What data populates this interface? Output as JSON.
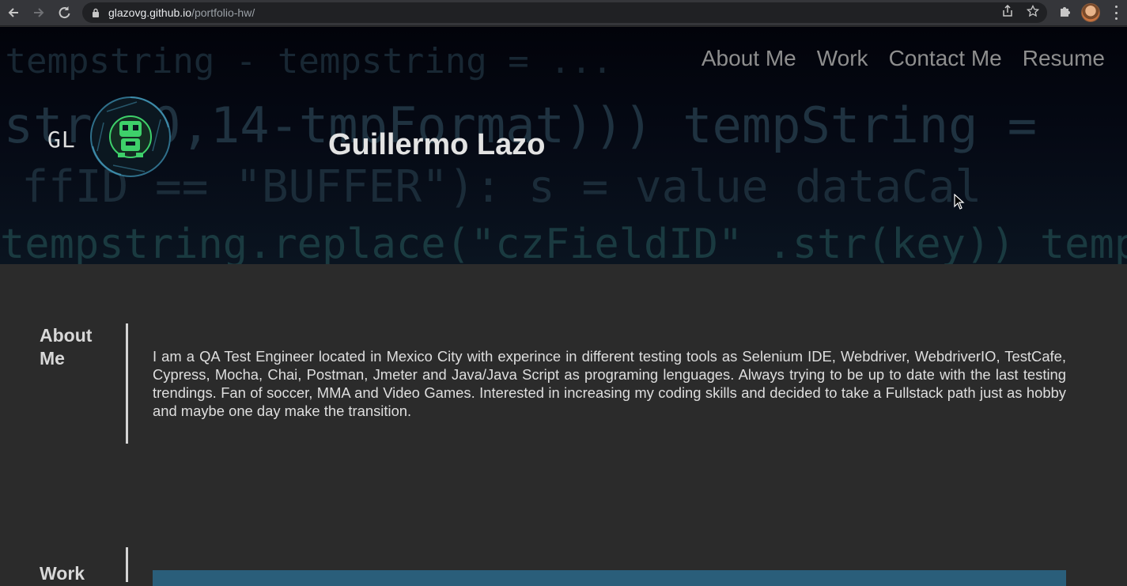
{
  "browser": {
    "back_icon": "arrow-left-icon",
    "forward_icon": "arrow-right-icon",
    "reload_icon": "reload-icon",
    "url_domain": "glazovg.github.io",
    "url_path": "/portfolio-hw/"
  },
  "header": {
    "nav": [
      "About Me",
      "Work",
      "Contact Me",
      "Resume"
    ],
    "logo_text": "GL",
    "title": "Guillermo Lazo"
  },
  "about": {
    "heading_line1": "About",
    "heading_line2": "Me",
    "text": "I am a QA Test Engineer located in Mexico City with experince in different testing tools as Selenium IDE, Webdriver, WebdriverIO, TestCafe, Cypress, Mocha, Chai, Postman, Jmeter and Java/Java Script as programing lenguages. Always trying to be up to date with the last testing trendings. Fan of soccer, MMA and Video Games. Interested in increasing my coding skills and decided to take a Fullstack path just as hobby and maybe one day make the transition."
  },
  "work": {
    "heading": "Work"
  },
  "colors": {
    "page_bg": "#2b2b2b",
    "nav_link": "#8e8e8e",
    "work_box": "#2a5e7a",
    "logo_accent": "#3ed06a"
  }
}
